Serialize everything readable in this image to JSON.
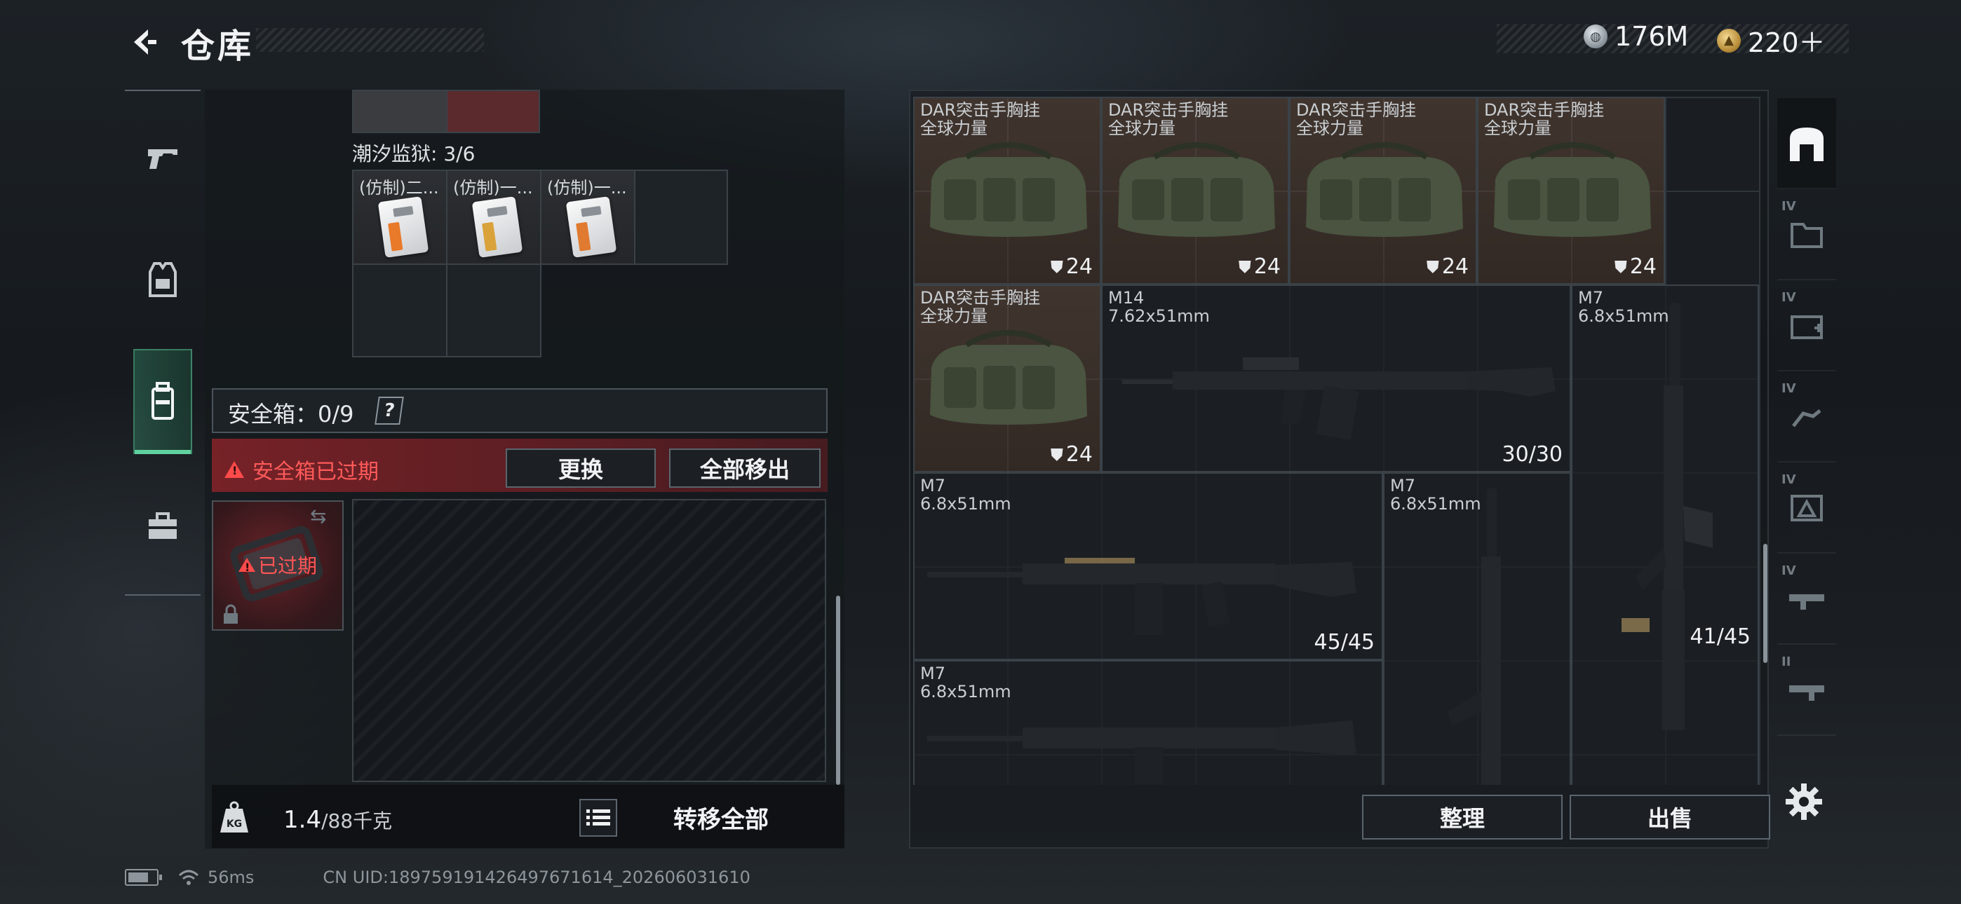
{
  "header": {
    "title": "仓库",
    "currency_silver": "176M",
    "currency_gold": "220＋"
  },
  "left_panel": {
    "tide_prison_label": "潮汐监狱: 3/6",
    "cards": [
      {
        "label": "(仿制)二...",
        "stripe": "#e87a2a"
      },
      {
        "label": "(仿制)一...",
        "stripe": "#d9a23b"
      },
      {
        "label": "(仿制)一...",
        "stripe": "#e07a30"
      }
    ],
    "safebox_title": "安全箱：0/9",
    "safebox_help": "?",
    "expired_notice": "安全箱已过期",
    "replace_button": "更换",
    "move_all_button": "全部移出",
    "expired_case_label": "已过期",
    "weight_current": "1.4",
    "weight_max": "/88千克",
    "transfer_all_button": "转移全部"
  },
  "right_panel": {
    "bags": [
      {
        "name": "DAR突击手胸挂",
        "sub": "全球力量",
        "count": "24"
      },
      {
        "name": "DAR突击手胸挂",
        "sub": "全球力量",
        "count": "24"
      },
      {
        "name": "DAR突击手胸挂",
        "sub": "全球力量",
        "count": "24"
      },
      {
        "name": "DAR突击手胸挂",
        "sub": "全球力量",
        "count": "24"
      },
      {
        "name": "DAR突击手胸挂",
        "sub": "全球力量",
        "count": "24"
      }
    ],
    "guns": [
      {
        "name": "M14",
        "sub": "7.62x51mm",
        "ammo": "30/30"
      },
      {
        "name": "M7",
        "sub": "6.8x51mm",
        "ammo": "41/45"
      },
      {
        "name": "M7",
        "sub": "6.8x51mm",
        "ammo": "45/45"
      },
      {
        "name": "M7",
        "sub": "6.8x51mm",
        "ammo": ""
      },
      {
        "name": "M7",
        "sub": "6.8x51mm",
        "ammo": ""
      }
    ],
    "sort_button": "整理",
    "sell_button": "出售",
    "tab_levels": [
      "IV",
      "IV",
      "IV",
      "IV",
      "IV",
      "II"
    ]
  },
  "status": {
    "ping": "56ms",
    "uid": "CN UID:189759191426497671614_202606031610"
  },
  "colors": {
    "accent_green": "#5fd2a0",
    "expired_red": "#ff5a5a",
    "bag_bg": "#6e503c"
  }
}
